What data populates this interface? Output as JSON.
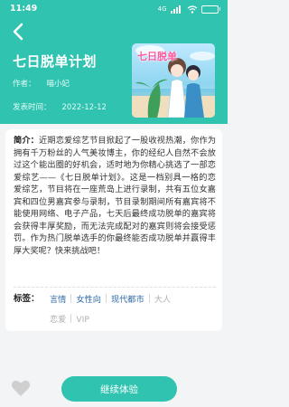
{
  "status_bar": {
    "time": "11:49",
    "network_label": "4G",
    "battery_level": "69",
    "battery_fraction": 0.69
  },
  "header": {
    "back_icon": "chevron-left-icon",
    "title": "七日脱单计划",
    "author_label": "作者：",
    "author_name": "喵小妃",
    "date_label": "发表时间：",
    "date": "2022-12-12",
    "cover_logo_text": "七日脱单"
  },
  "detail": {
    "intro_label": "简介：",
    "intro_text": "近期恋爱综艺节目掀起了一股收视热潮，你作为拥有千万粉丝的人气美妆博主，你的经纪人自然不会放过这个能出圈的好机会，适时地为你精心挑选了一部恋爱综艺——《七日脱单计划》。这是一档别具一格的恋爱综艺，节目将在一座荒岛上进行录制，共有五位女嘉宾和四位男嘉宾参与录制，节目录制期间所有嘉宾将不能使用网络、电子产品，七天后最终成功脱单的嘉宾将会获得丰厚奖励，而无法完成配对的嘉宾则将会接受惩罚。作为热门脱单选手的你最终能否成功脱单并赢得丰厚大奖呢？快来挑战吧！",
    "tags_label": "标签：",
    "tags": [
      {
        "label": "言情",
        "muted": false
      },
      {
        "label": "女性向",
        "muted": false
      },
      {
        "label": "现代都市",
        "muted": false
      },
      {
        "label": "大人",
        "muted": true
      },
      {
        "label": "恋爱",
        "muted": true
      },
      {
        "label": "VIP",
        "muted": true
      }
    ]
  },
  "footer": {
    "favorite_icon": "heart-icon",
    "continue_label": "继续体验"
  },
  "colors": {
    "accent": "#2fc3b0",
    "tag_link": "#2f6aa8",
    "tag_muted": "#b0b0b0",
    "background": "#f3f4f6"
  }
}
